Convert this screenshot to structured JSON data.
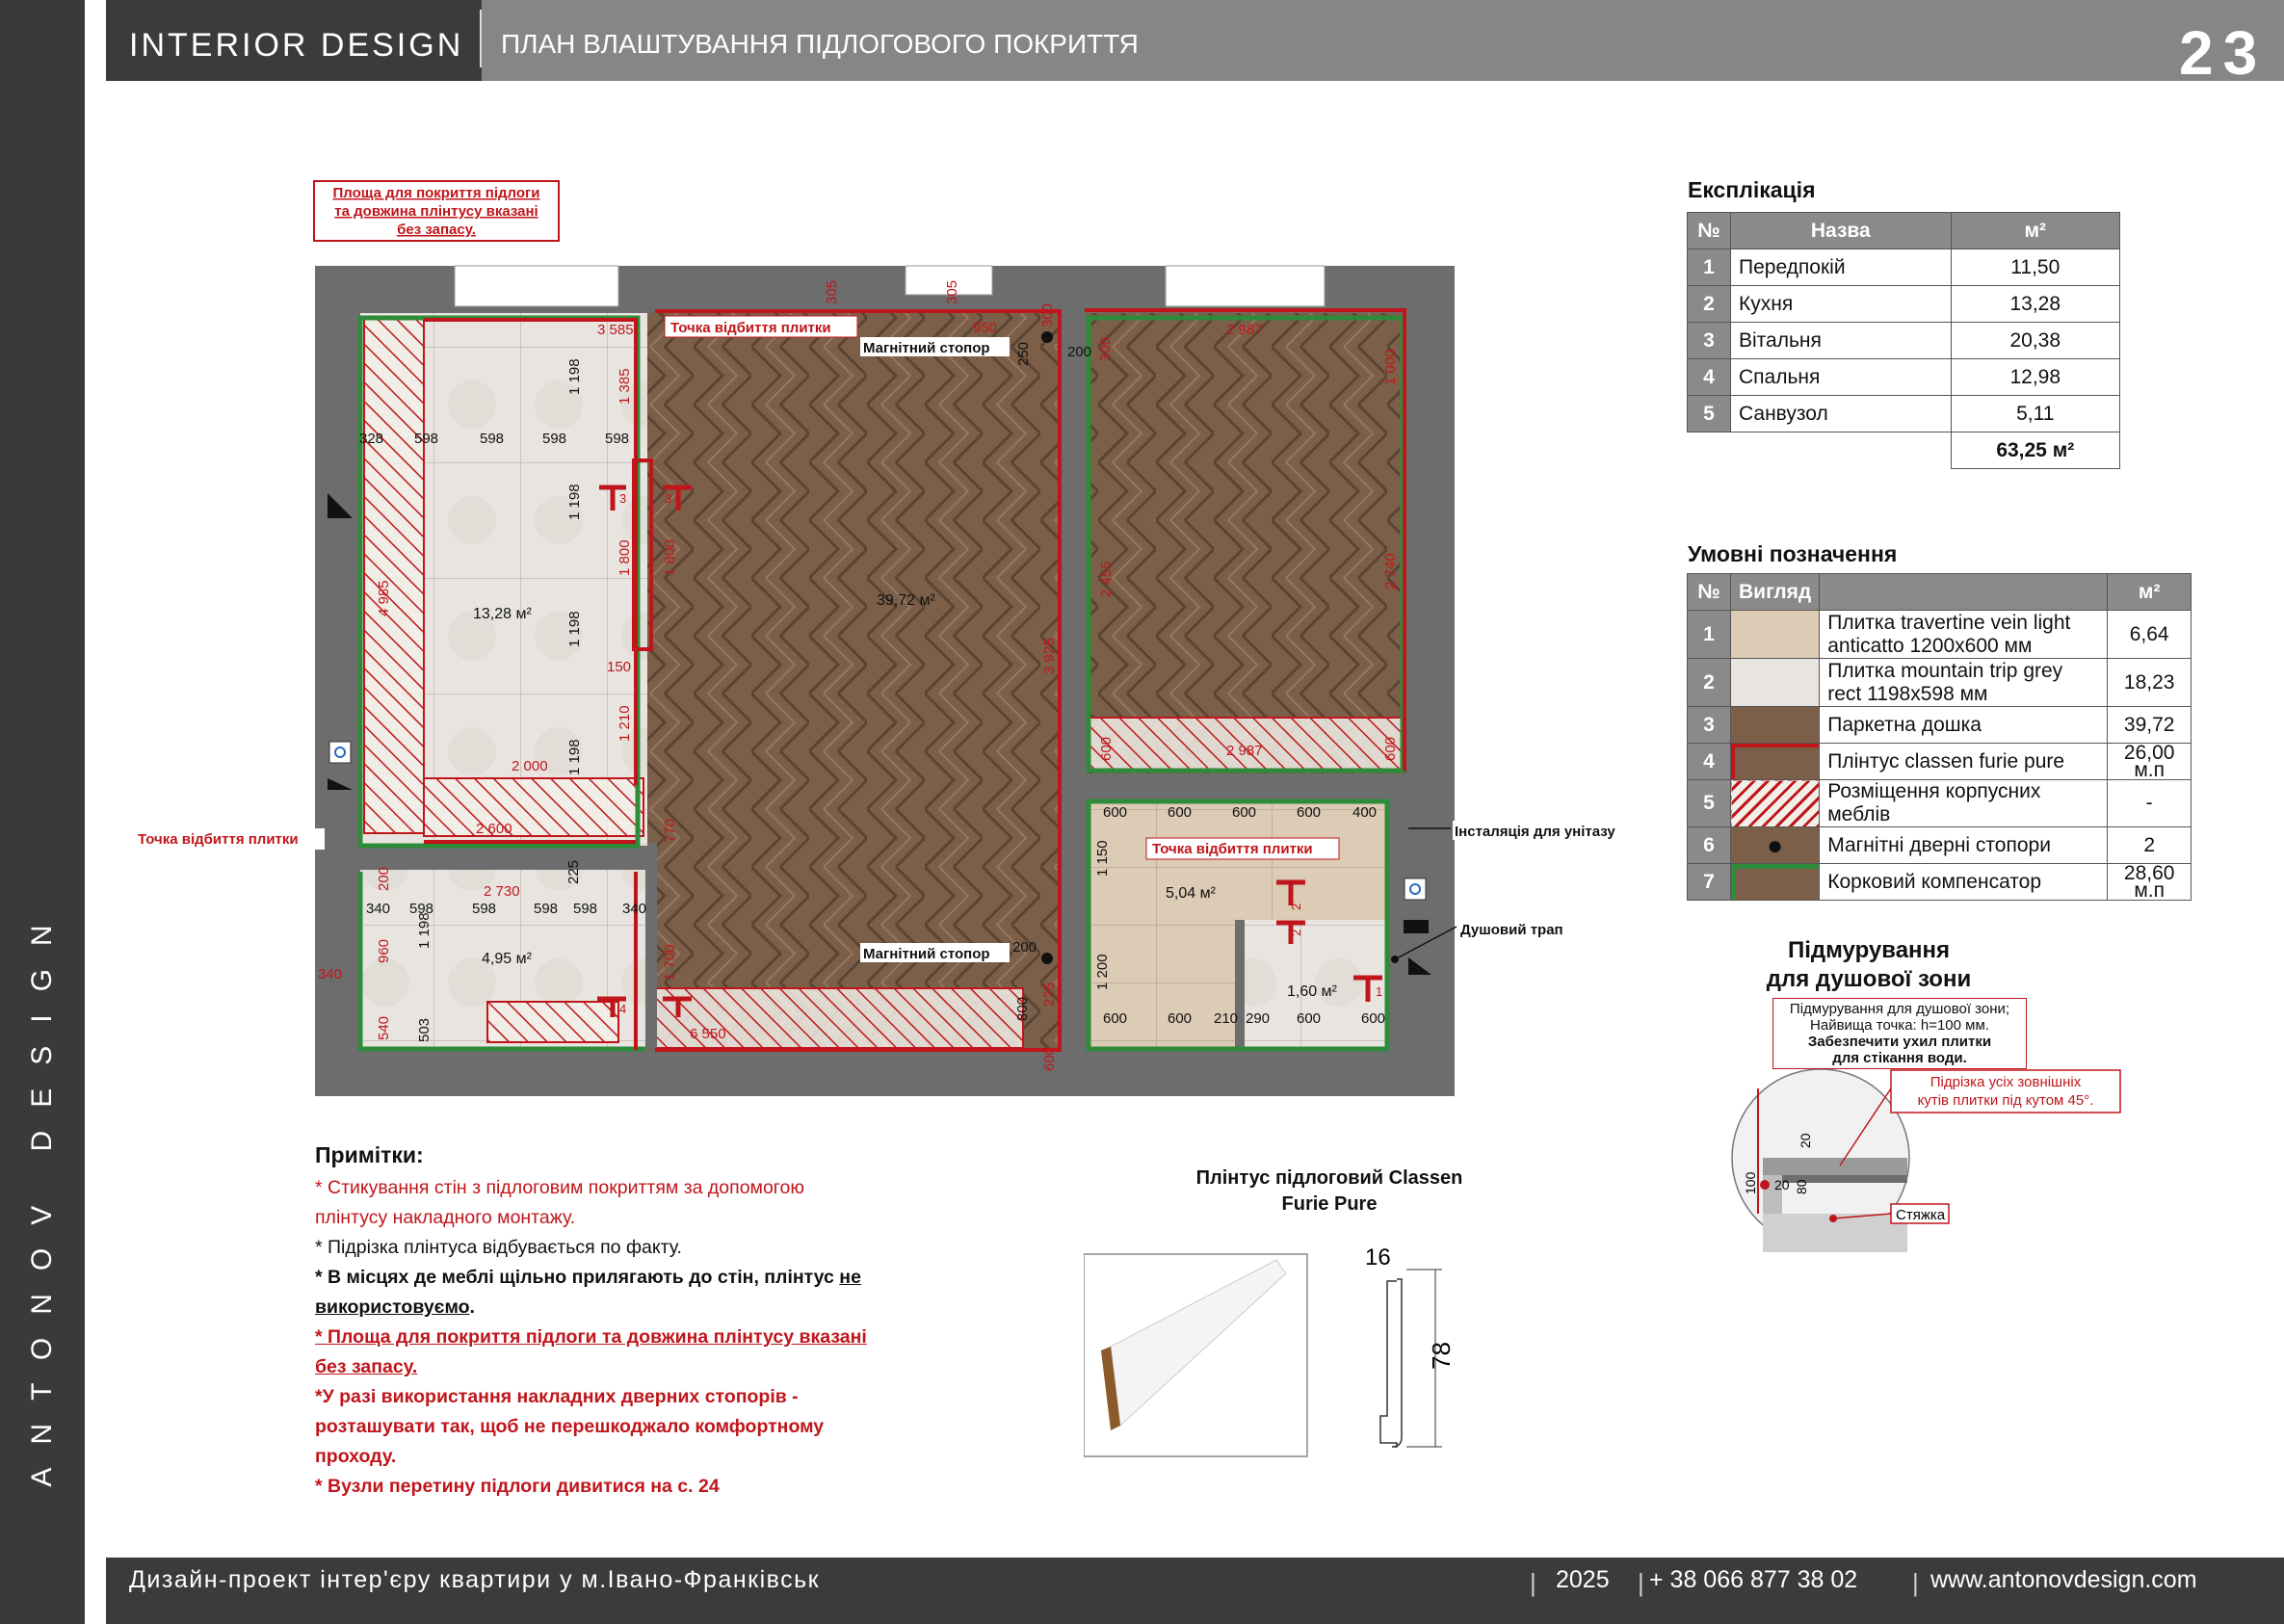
{
  "header": {
    "brand": "INTERIOR  DESIGN",
    "subtitle": "ПЛАН ВЛАШТУВАННЯ ПІДЛОГОВОГО ПОКРИТТЯ",
    "page_number": "23"
  },
  "side_text": "ANTONOV DESIGN",
  "footer": {
    "project": "Дизайн-проект інтер'єру квартири у м.Івано-Франківськ",
    "year": "2025",
    "phone": "+ 38 066 877 38 02",
    "site": "www.antonovdesign.com"
  },
  "colors": {
    "dark": "#3b3b3b",
    "grey": "#868686",
    "red": "#c0161b",
    "green": "#2e8b3a",
    "wood": "#7a5f48",
    "tile": "#e6e2dc"
  },
  "plan": {
    "note_box": [
      "Площа для покриття підлоги",
      "та довжина плінтусу вказані",
      "без запасу."
    ],
    "tile_point": "Точка відбиття плитки",
    "magnet_stopper": "Магнітний стопор",
    "toilet_install": "Інсталяція для унітазу",
    "shower_drain": "Душовий трап",
    "areas": {
      "kitchen": "13,28 м²",
      "main": "39,72 м²",
      "hall": "4,95 м²",
      "bath": "5,04 м²",
      "shower": "1,60 м²"
    },
    "dims": {
      "kitchen_row": [
        "328",
        "598",
        "598",
        "598",
        "598"
      ],
      "hall_row": [
        "340",
        "598",
        "598",
        "598",
        "598",
        "340"
      ],
      "bath_top_row": [
        "600",
        "600",
        "600",
        "600",
        "400"
      ],
      "bath_bottom_row": [
        "600",
        "600",
        "210",
        "290",
        "600",
        "600"
      ],
      "d3585": "3 585",
      "d2987": "2 987",
      "d2987b": "2 987",
      "d2000": "2 000",
      "d2600": "2 600",
      "d2730": "2 730",
      "d6550": "6 550",
      "d1198": "1 198",
      "d1385": "1 385",
      "d4985": "4 985",
      "d1800": "1 800",
      "d1210": "1 210",
      "d150": "150",
      "d770": "770",
      "d1700": "1 700",
      "d960": "960",
      "d540": "540",
      "d503": "503",
      "d200": "200",
      "d225": "225",
      "d305": "305",
      "d950": "950",
      "d300": "300",
      "d250": "250",
      "d1000": "1 000",
      "d2455": "2 455",
      "d2740": "2 740",
      "d3925": "3 925",
      "d600": "600",
      "d1150": "1 150",
      "d1200": "1 200",
      "d800": "800",
      "d3": "3",
      "d2": "2",
      "d1": "1",
      "d4": "4"
    }
  },
  "explication": {
    "title": "Експлікація",
    "headers": [
      "№",
      "Назва",
      "м²"
    ],
    "rows": [
      {
        "n": "1",
        "name": "Передпокій",
        "area": "11,50"
      },
      {
        "n": "2",
        "name": "Кухня",
        "area": "13,28"
      },
      {
        "n": "3",
        "name": "Вітальня",
        "area": "20,38"
      },
      {
        "n": "4",
        "name": "Спальня",
        "area": "12,98"
      },
      {
        "n": "5",
        "name": "Санвузол",
        "area": "5,11"
      }
    ],
    "total": "63,25 м²"
  },
  "legend": {
    "title": "Умовні позначення",
    "headers": [
      "№",
      "Вигляд",
      "",
      "м²"
    ],
    "rows": [
      {
        "n": "1",
        "swatch": "travertine",
        "name": "Плитка travertine vein light anticatto 1200х600 мм",
        "value": "6,64"
      },
      {
        "n": "2",
        "swatch": "grey-tile",
        "name": "Плитка mountain trip grey rect 1198х598 мм",
        "value": "18,23"
      },
      {
        "n": "3",
        "swatch": "parquet",
        "name": "Паркетна дошка",
        "value": "39,72"
      },
      {
        "n": "4",
        "swatch": "plinth",
        "name": "Плінтус classen furie pure",
        "value": "26,00 м.п"
      },
      {
        "n": "5",
        "swatch": "hatch",
        "name": "Розміщення корпусних меблів",
        "value": "-"
      },
      {
        "n": "6",
        "swatch": "stopper",
        "name": "Магнітні дверні стопори",
        "value": "2"
      },
      {
        "n": "7",
        "swatch": "cork",
        "name": "Корковий компенсатор",
        "value": "28,60 м.п"
      }
    ]
  },
  "shower": {
    "title": [
      "Підмурування",
      "для душової зони"
    ],
    "note": [
      "Підмурування для душової зони;",
      "Найвища точка: h=100 мм.",
      "Забезпечити ухил плитки",
      "для стікання води."
    ],
    "cut_note": [
      "Підрізка усіх зовнішніх",
      "кутів плитки під кутом 45°."
    ],
    "screed": "Стяжка",
    "dims": {
      "h100": "100",
      "h80": "80",
      "h20": "20",
      "w20": "20"
    }
  },
  "notes": {
    "title": "Примітки:",
    "items": [
      "* Стикування стін з підлоговим покриттям за допомогою",
      "плінтусу накладного монтажу.",
      "* Підрізка плінтуса відбувається по факту.",
      "* В місцях де меблі щільно прилягають до стін, плінтус ",
      "не",
      "використовуємо",
      ".",
      "* Площа для покриття підлоги та довжина плінтусу вказані",
      "без запасу.",
      "*У разі використання накладних дверних стопорів -",
      "розташувати так, щоб не перешкоджало комфортному",
      "проходу.",
      "* Вузли перетину підлоги дивитися на с. 24"
    ]
  },
  "plinth": {
    "title": [
      "Плінтус підлоговий Classen",
      "Furie Pure"
    ],
    "w": "16",
    "h": "78"
  }
}
